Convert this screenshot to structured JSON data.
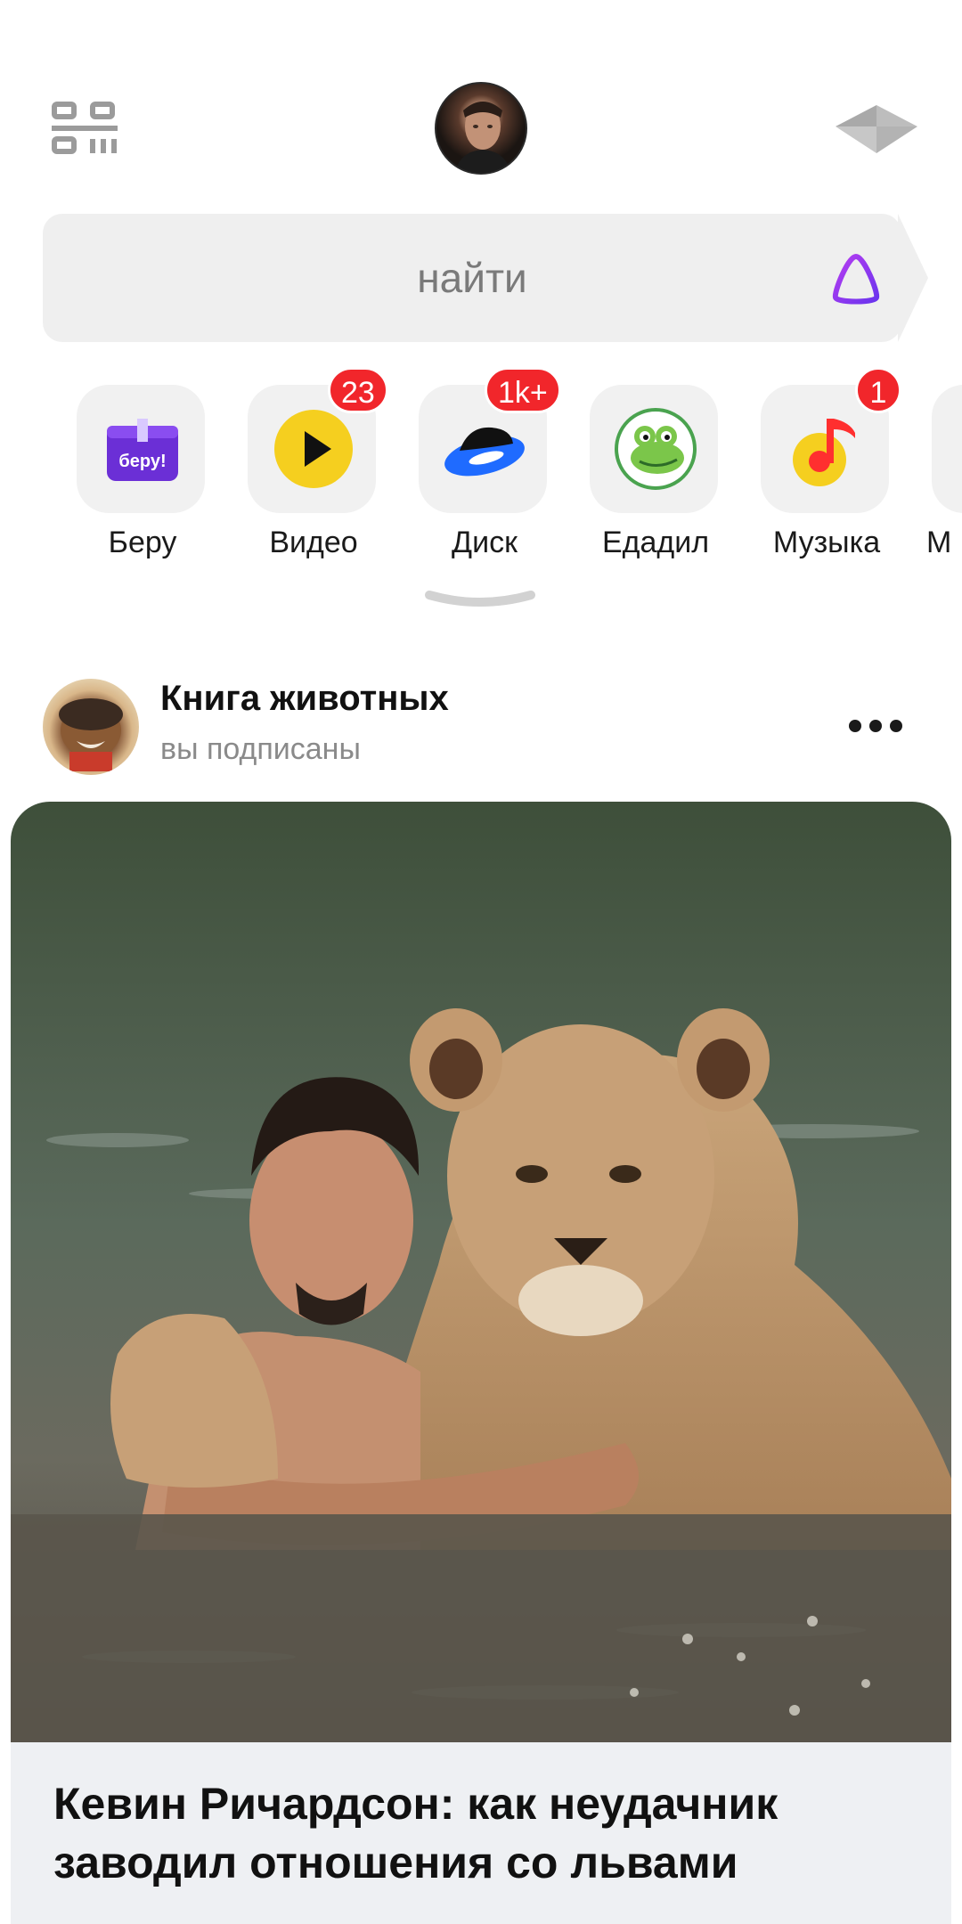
{
  "header": {
    "qr_icon": "qr-code-icon",
    "avatar_icon": "user-avatar",
    "share_icon": "paper-plane-icon"
  },
  "search": {
    "placeholder": "найти",
    "assistant_icon": "alice-icon",
    "accent": "#9b3cf0"
  },
  "services": [
    {
      "label": "Беру",
      "icon": "beru-icon",
      "badge": "",
      "icon_text": "беру!"
    },
    {
      "label": "Видео",
      "icon": "video-play-icon",
      "badge": "23"
    },
    {
      "label": "Диск",
      "icon": "disk-icon",
      "badge": "1k+"
    },
    {
      "label": "Едадил",
      "icon": "edadil-croc-icon",
      "badge": ""
    },
    {
      "label": "Музыка",
      "icon": "music-note-icon",
      "badge": "1"
    },
    {
      "label": "М",
      "icon": "partial-service-icon",
      "badge": ""
    }
  ],
  "feed": {
    "channel": {
      "title": "Книга животных",
      "subtitle": "вы подписаны"
    },
    "card": {
      "title": "Кевин Ричардсон: как неудачник заводил отношения со львами",
      "image_icon": "man-with-lioness-photo"
    }
  },
  "colors": {
    "badge": "#f1262b",
    "search_bg": "#efefef",
    "tile_bg": "#f1f1f1"
  }
}
